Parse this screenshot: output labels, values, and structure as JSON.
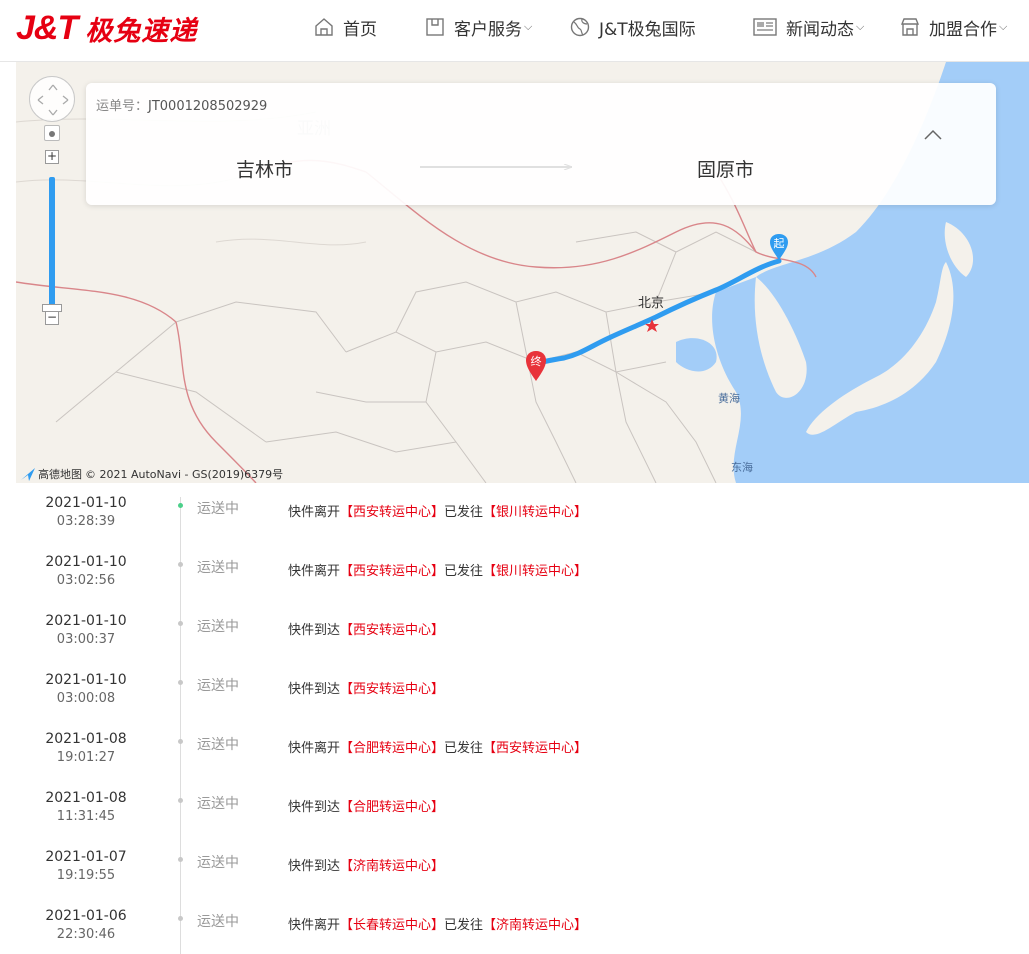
{
  "header": {
    "logo_jt": "J&T",
    "logo_cn": "极兔速递",
    "nav": [
      {
        "label": "首页",
        "icon": "home-icon",
        "caret": ""
      },
      {
        "label": "客户服务",
        "icon": "package-icon",
        "caret": "⌵"
      },
      {
        "label": "J&T极兔国际",
        "icon": "globe-icon",
        "caret": ""
      },
      {
        "label": "新闻动态",
        "icon": "news-icon",
        "caret": "⌵"
      },
      {
        "label": "加盟合作",
        "icon": "store-icon",
        "caret": "⌵"
      }
    ]
  },
  "map": {
    "waybill_label": "运单号：",
    "waybill_no": "JT0001208502929",
    "from_city": "吉林市",
    "to_city": "固原市",
    "zoom_in": "+",
    "zoom_out": "−",
    "labels": {
      "continent": "亚洲",
      "beijing": "北京",
      "yellow_sea": "黄海",
      "east_sea": "东海"
    },
    "markers": {
      "start": "起",
      "end": "终"
    },
    "attribution_logo": "高德地图",
    "attribution_text": "© 2021 AutoNavi - GS(2019)6379号",
    "colors": {
      "route": "#2f9cf0",
      "start_marker": "#2f9cf0",
      "end_marker": "#e8333a",
      "sea": "#a3cdf8"
    }
  },
  "timeline": [
    {
      "date": "2021-01-10",
      "time": "03:28:39",
      "status": "运送中",
      "active": true,
      "parts": [
        {
          "t": "快件离开"
        },
        {
          "t": "【西安转运中心】",
          "hl": true
        },
        {
          "t": "已发往"
        },
        {
          "t": "【银川转运中心】",
          "hl": true
        }
      ]
    },
    {
      "date": "2021-01-10",
      "time": "03:02:56",
      "status": "运送中",
      "active": false,
      "parts": [
        {
          "t": "快件离开"
        },
        {
          "t": "【西安转运中心】",
          "hl": true
        },
        {
          "t": "已发往"
        },
        {
          "t": "【银川转运中心】",
          "hl": true
        }
      ]
    },
    {
      "date": "2021-01-10",
      "time": "03:00:37",
      "status": "运送中",
      "active": false,
      "parts": [
        {
          "t": "快件到达"
        },
        {
          "t": "【西安转运中心】",
          "hl": true
        }
      ]
    },
    {
      "date": "2021-01-10",
      "time": "03:00:08",
      "status": "运送中",
      "active": false,
      "parts": [
        {
          "t": "快件到达"
        },
        {
          "t": "【西安转运中心】",
          "hl": true
        }
      ]
    },
    {
      "date": "2021-01-08",
      "time": "19:01:27",
      "status": "运送中",
      "active": false,
      "parts": [
        {
          "t": "快件离开"
        },
        {
          "t": "【合肥转运中心】",
          "hl": true
        },
        {
          "t": "已发往"
        },
        {
          "t": "【西安转运中心】",
          "hl": true
        }
      ]
    },
    {
      "date": "2021-01-08",
      "time": "11:31:45",
      "status": "运送中",
      "active": false,
      "parts": [
        {
          "t": "快件到达"
        },
        {
          "t": "【合肥转运中心】",
          "hl": true
        }
      ]
    },
    {
      "date": "2021-01-07",
      "time": "19:19:55",
      "status": "运送中",
      "active": false,
      "parts": [
        {
          "t": "快件到达"
        },
        {
          "t": "【济南转运中心】",
          "hl": true
        }
      ]
    },
    {
      "date": "2021-01-06",
      "time": "22:30:46",
      "status": "运送中",
      "active": false,
      "parts": [
        {
          "t": "快件离开"
        },
        {
          "t": "【长春转运中心】",
          "hl": true
        },
        {
          "t": "已发往"
        },
        {
          "t": "【济南转运中心】",
          "hl": true
        }
      ]
    }
  ]
}
